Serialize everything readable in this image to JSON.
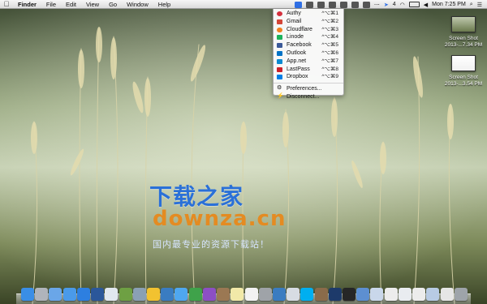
{
  "menubar": {
    "apple_icon": "apple-icon",
    "items": [
      "Finder",
      "File",
      "Edit",
      "View",
      "Go",
      "Window",
      "Help"
    ],
    "status": {
      "icons": [
        "authy-icon",
        "app-icon",
        "app-icon",
        "app-icon",
        "app-icon",
        "app-icon",
        "app-icon",
        "more-icon",
        "cursor-icon",
        "wifi-icon",
        "battery-icon",
        "volume-icon"
      ],
      "app_badge": "4",
      "time": "Mon 7:25 PM"
    }
  },
  "dropdown": {
    "items": [
      {
        "label": "Authy",
        "shortcut": "^⌥⌘1",
        "icon": "authy-icon",
        "color": "#d42f3d"
      },
      {
        "label": "Gmail",
        "shortcut": "^⌥⌘2",
        "icon": "gmail-icon",
        "color": "#d44638"
      },
      {
        "label": "Cloudflare",
        "shortcut": "^⌥⌘3",
        "icon": "cloud-icon",
        "color": "#f38020"
      },
      {
        "label": "Linode",
        "shortcut": "^⌥⌘4",
        "icon": "linode-icon",
        "color": "#1cb35c"
      },
      {
        "label": "Facebook",
        "shortcut": "^⌥⌘5",
        "icon": "facebook-icon",
        "color": "#3b5998"
      },
      {
        "label": "Outlook",
        "shortcut": "^⌥⌘6",
        "icon": "outlook-icon",
        "color": "#0072c6"
      },
      {
        "label": "App.net",
        "shortcut": "^⌥⌘7",
        "icon": "appnet-icon",
        "color": "#0a8ad2"
      },
      {
        "label": "LastPass",
        "shortcut": "^⌥⌘8",
        "icon": "lastpass-icon",
        "color": "#cc2029"
      },
      {
        "label": "Dropbox",
        "shortcut": "^⌥⌘9",
        "icon": "dropbox-icon",
        "color": "#007ee5"
      }
    ],
    "preferences": {
      "label": "Preferences...",
      "icon": "gear-icon"
    },
    "disconnect": {
      "label": "Disconnect...",
      "icon": "plug-icon"
    }
  },
  "desktop": {
    "files": [
      {
        "name": "Screen Shot",
        "detail": "2013-...7.34 PM"
      },
      {
        "name": "Screen Shot",
        "detail": "2013-...3.54 PM"
      }
    ]
  },
  "watermark": {
    "title_cn": "下载之家",
    "domain": "downza.cn",
    "subtitle_cn": "国内最专业的资源下载站！"
  },
  "dock": {
    "apps": [
      {
        "name": "finder-icon",
        "color": "#3a8ee6"
      },
      {
        "name": "launchpad-icon",
        "color": "#b0b4bb"
      },
      {
        "name": "safari-icon",
        "color": "#6aa6e8"
      },
      {
        "name": "app-store-icon",
        "color": "#4a9ae9"
      },
      {
        "name": "itunes-icon",
        "color": "#2d7fe0"
      },
      {
        "name": "word-icon",
        "color": "#2b579a"
      },
      {
        "name": "app-icon",
        "color": "#e1e7ef"
      },
      {
        "name": "pen-icon",
        "color": "#6ea043"
      },
      {
        "name": "network-icon",
        "color": "#8aa0b5"
      },
      {
        "name": "chrome-icon",
        "color": "#f2c230"
      },
      {
        "name": "app-icon",
        "color": "#3a7cc1"
      },
      {
        "name": "messages-icon",
        "color": "#4fa7f0"
      },
      {
        "name": "facetime-icon",
        "color": "#3fa24a"
      },
      {
        "name": "omnifocus-icon",
        "color": "#8c4fc4"
      },
      {
        "name": "contacts-icon",
        "color": "#9b7853"
      },
      {
        "name": "notes-icon",
        "color": "#f1e9a8"
      },
      {
        "name": "calendar-icon",
        "color": "#f2f2f2"
      },
      {
        "name": "system-prefs-icon",
        "color": "#9fa3a8"
      },
      {
        "name": "app-icon",
        "color": "#3a7cc1"
      },
      {
        "name": "mail-icon",
        "color": "#d7dce3"
      },
      {
        "name": "skype-icon",
        "color": "#00aff0"
      },
      {
        "name": "app-icon",
        "color": "#8a6b4a"
      },
      {
        "name": "photoshop-icon",
        "color": "#1d3a6a"
      },
      {
        "name": "terminal-icon",
        "color": "#262626"
      },
      {
        "name": "app-icon",
        "color": "#5d8fd1"
      },
      {
        "name": "folder-icon",
        "color": "#c9d7ea"
      },
      {
        "name": "document-icon",
        "color": "#ececec"
      },
      {
        "name": "document-icon",
        "color": "#e9ecf0"
      },
      {
        "name": "document-icon",
        "color": "#ececec"
      },
      {
        "name": "folder-icon",
        "color": "#b8cbe4"
      },
      {
        "name": "document-icon",
        "color": "#e6e6e6"
      },
      {
        "name": "trash-icon",
        "color": "#9ea4aa"
      }
    ]
  }
}
